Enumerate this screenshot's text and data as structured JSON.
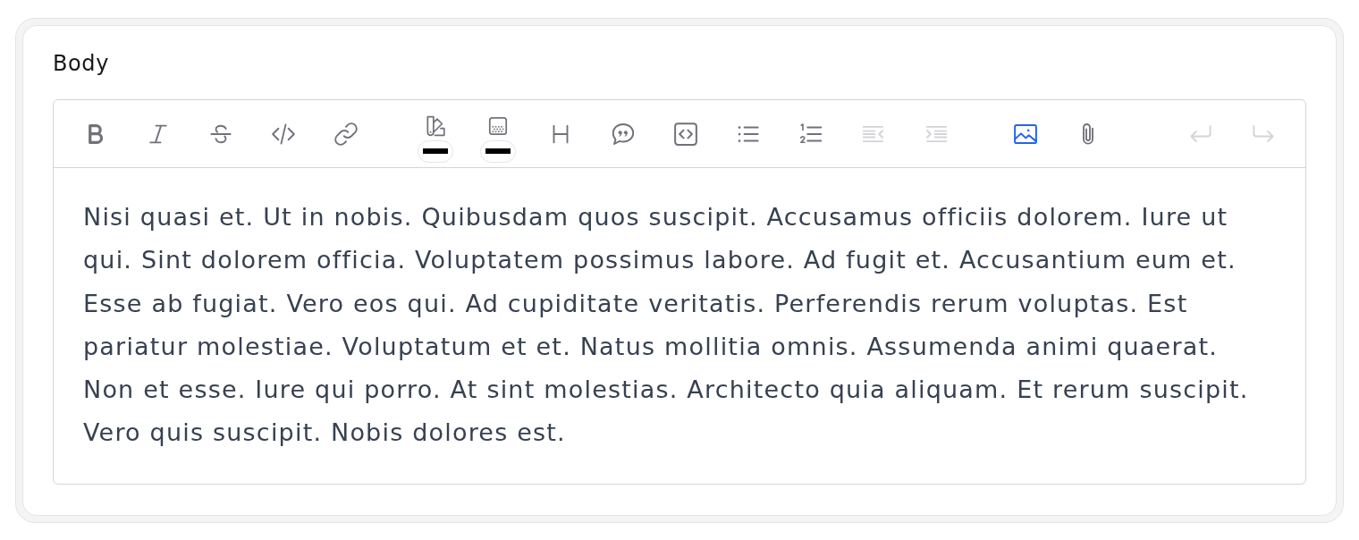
{
  "field": {
    "label": "Body"
  },
  "toolbar": {
    "groups": [
      {
        "tools": [
          {
            "kind": "bold",
            "active": false,
            "disabled": false
          },
          {
            "kind": "italic",
            "active": false,
            "disabled": false
          },
          {
            "kind": "strike",
            "active": false,
            "disabled": false
          },
          {
            "kind": "code",
            "active": false,
            "disabled": false
          },
          {
            "kind": "link",
            "active": false,
            "disabled": false
          }
        ]
      },
      {
        "tools": [
          {
            "kind": "text-color",
            "color": "#000000",
            "active": false,
            "disabled": false
          },
          {
            "kind": "highlight",
            "color": "#000000",
            "active": false,
            "disabled": false
          },
          {
            "kind": "heading",
            "active": false,
            "disabled": false
          },
          {
            "kind": "quote",
            "active": false,
            "disabled": false
          },
          {
            "kind": "code-block",
            "active": false,
            "disabled": false
          },
          {
            "kind": "bullet-list",
            "active": false,
            "disabled": false
          },
          {
            "kind": "ordered-list",
            "active": false,
            "disabled": false
          },
          {
            "kind": "outdent",
            "active": false,
            "disabled": true
          },
          {
            "kind": "indent",
            "active": false,
            "disabled": true
          }
        ]
      },
      {
        "tools": [
          {
            "kind": "image",
            "active": true,
            "disabled": false
          },
          {
            "kind": "attachment",
            "active": false,
            "disabled": false
          }
        ]
      },
      {
        "tools": [
          {
            "kind": "undo",
            "active": false,
            "disabled": true
          },
          {
            "kind": "redo",
            "active": false,
            "disabled": true
          }
        ]
      }
    ]
  },
  "editor": {
    "value": "Nisi quasi et. Ut in nobis. Quibusdam quos suscipit. Accusamus officiis dolorem. Iure ut qui. Sint dolorem officia. Voluptatem possimus labore. Ad fugit et. Accusantium eum et. Esse ab fugiat. Vero eos qui. Ad cupiditate veritatis. Perferendis rerum voluptas. Est pariatur molestiae. Voluptatum et et. Natus mollitia omnis. Assumenda animi quaerat. Non et esse. Iure qui porro. At sint molestias. Architecto quia aliquam. Et rerum suscipit. Vero quis suscipit. Nobis dolores est."
  }
}
